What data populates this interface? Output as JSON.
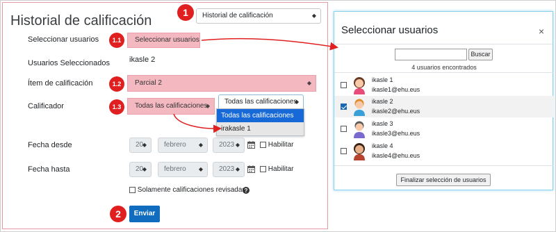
{
  "page": {
    "title": "Historial de calificación",
    "report_select": "Historial de calificación"
  },
  "form": {
    "select_users_label": "Seleccionar usuarios",
    "select_users_button": "Seleccionar usuarios",
    "selected_users_label": "Usuarios Seleccionados",
    "selected_users_value": "ikasle 2",
    "grade_item_label": "Ítem de calificación",
    "grade_item_value": "Parcial 2",
    "grader_label": "Calificador",
    "grader_value": "Todas las calificaciones",
    "grader_dropdown_value": "Todas las calificaciones",
    "grader_options": [
      "Todas las calificaciones",
      "irakasle 1"
    ],
    "date_from_label": "Fecha desde",
    "date_to_label": "Fecha hasta",
    "date_from": {
      "day": "20",
      "month": "febrero",
      "year": "2023",
      "enable_label": "Habilitar"
    },
    "date_to": {
      "day": "20",
      "month": "febrero",
      "year": "2023",
      "enable_label": "Habilitar"
    },
    "revised_only_label": "Solamente calificaciones revisadas",
    "submit_label": "Enviar"
  },
  "badges": {
    "b1": "1",
    "b11": "1.1",
    "b12": "1.2",
    "b13": "1.3",
    "b2": "2"
  },
  "modal": {
    "title": "Seleccionar usuarios",
    "close": "×",
    "search_placeholder": "",
    "search_button": "Buscar",
    "found_text": "4 usuarios encontrados",
    "users": [
      {
        "name": "ikasle 1",
        "email": "ikasle1@ehu.eus",
        "checked": false
      },
      {
        "name": "ikasle 2",
        "email": "ikasle2@ehu.eus",
        "checked": true
      },
      {
        "name": "ikasle 3",
        "email": "ikasle3@ehu.eus",
        "checked": false
      },
      {
        "name": "ikasle 4",
        "email": "ikasle4@ehu.eus",
        "checked": false
      }
    ],
    "finalize_button": "Finalizar selección de usuarios"
  },
  "icons": {
    "caret": "◆",
    "calendar": "calendar-icon",
    "help": "help-icon"
  },
  "colors": {
    "annotation_red": "#e02020",
    "highlight_pink": "#f4b8c0",
    "primary_blue": "#0f6cbf",
    "modal_border": "#89d2ee"
  }
}
